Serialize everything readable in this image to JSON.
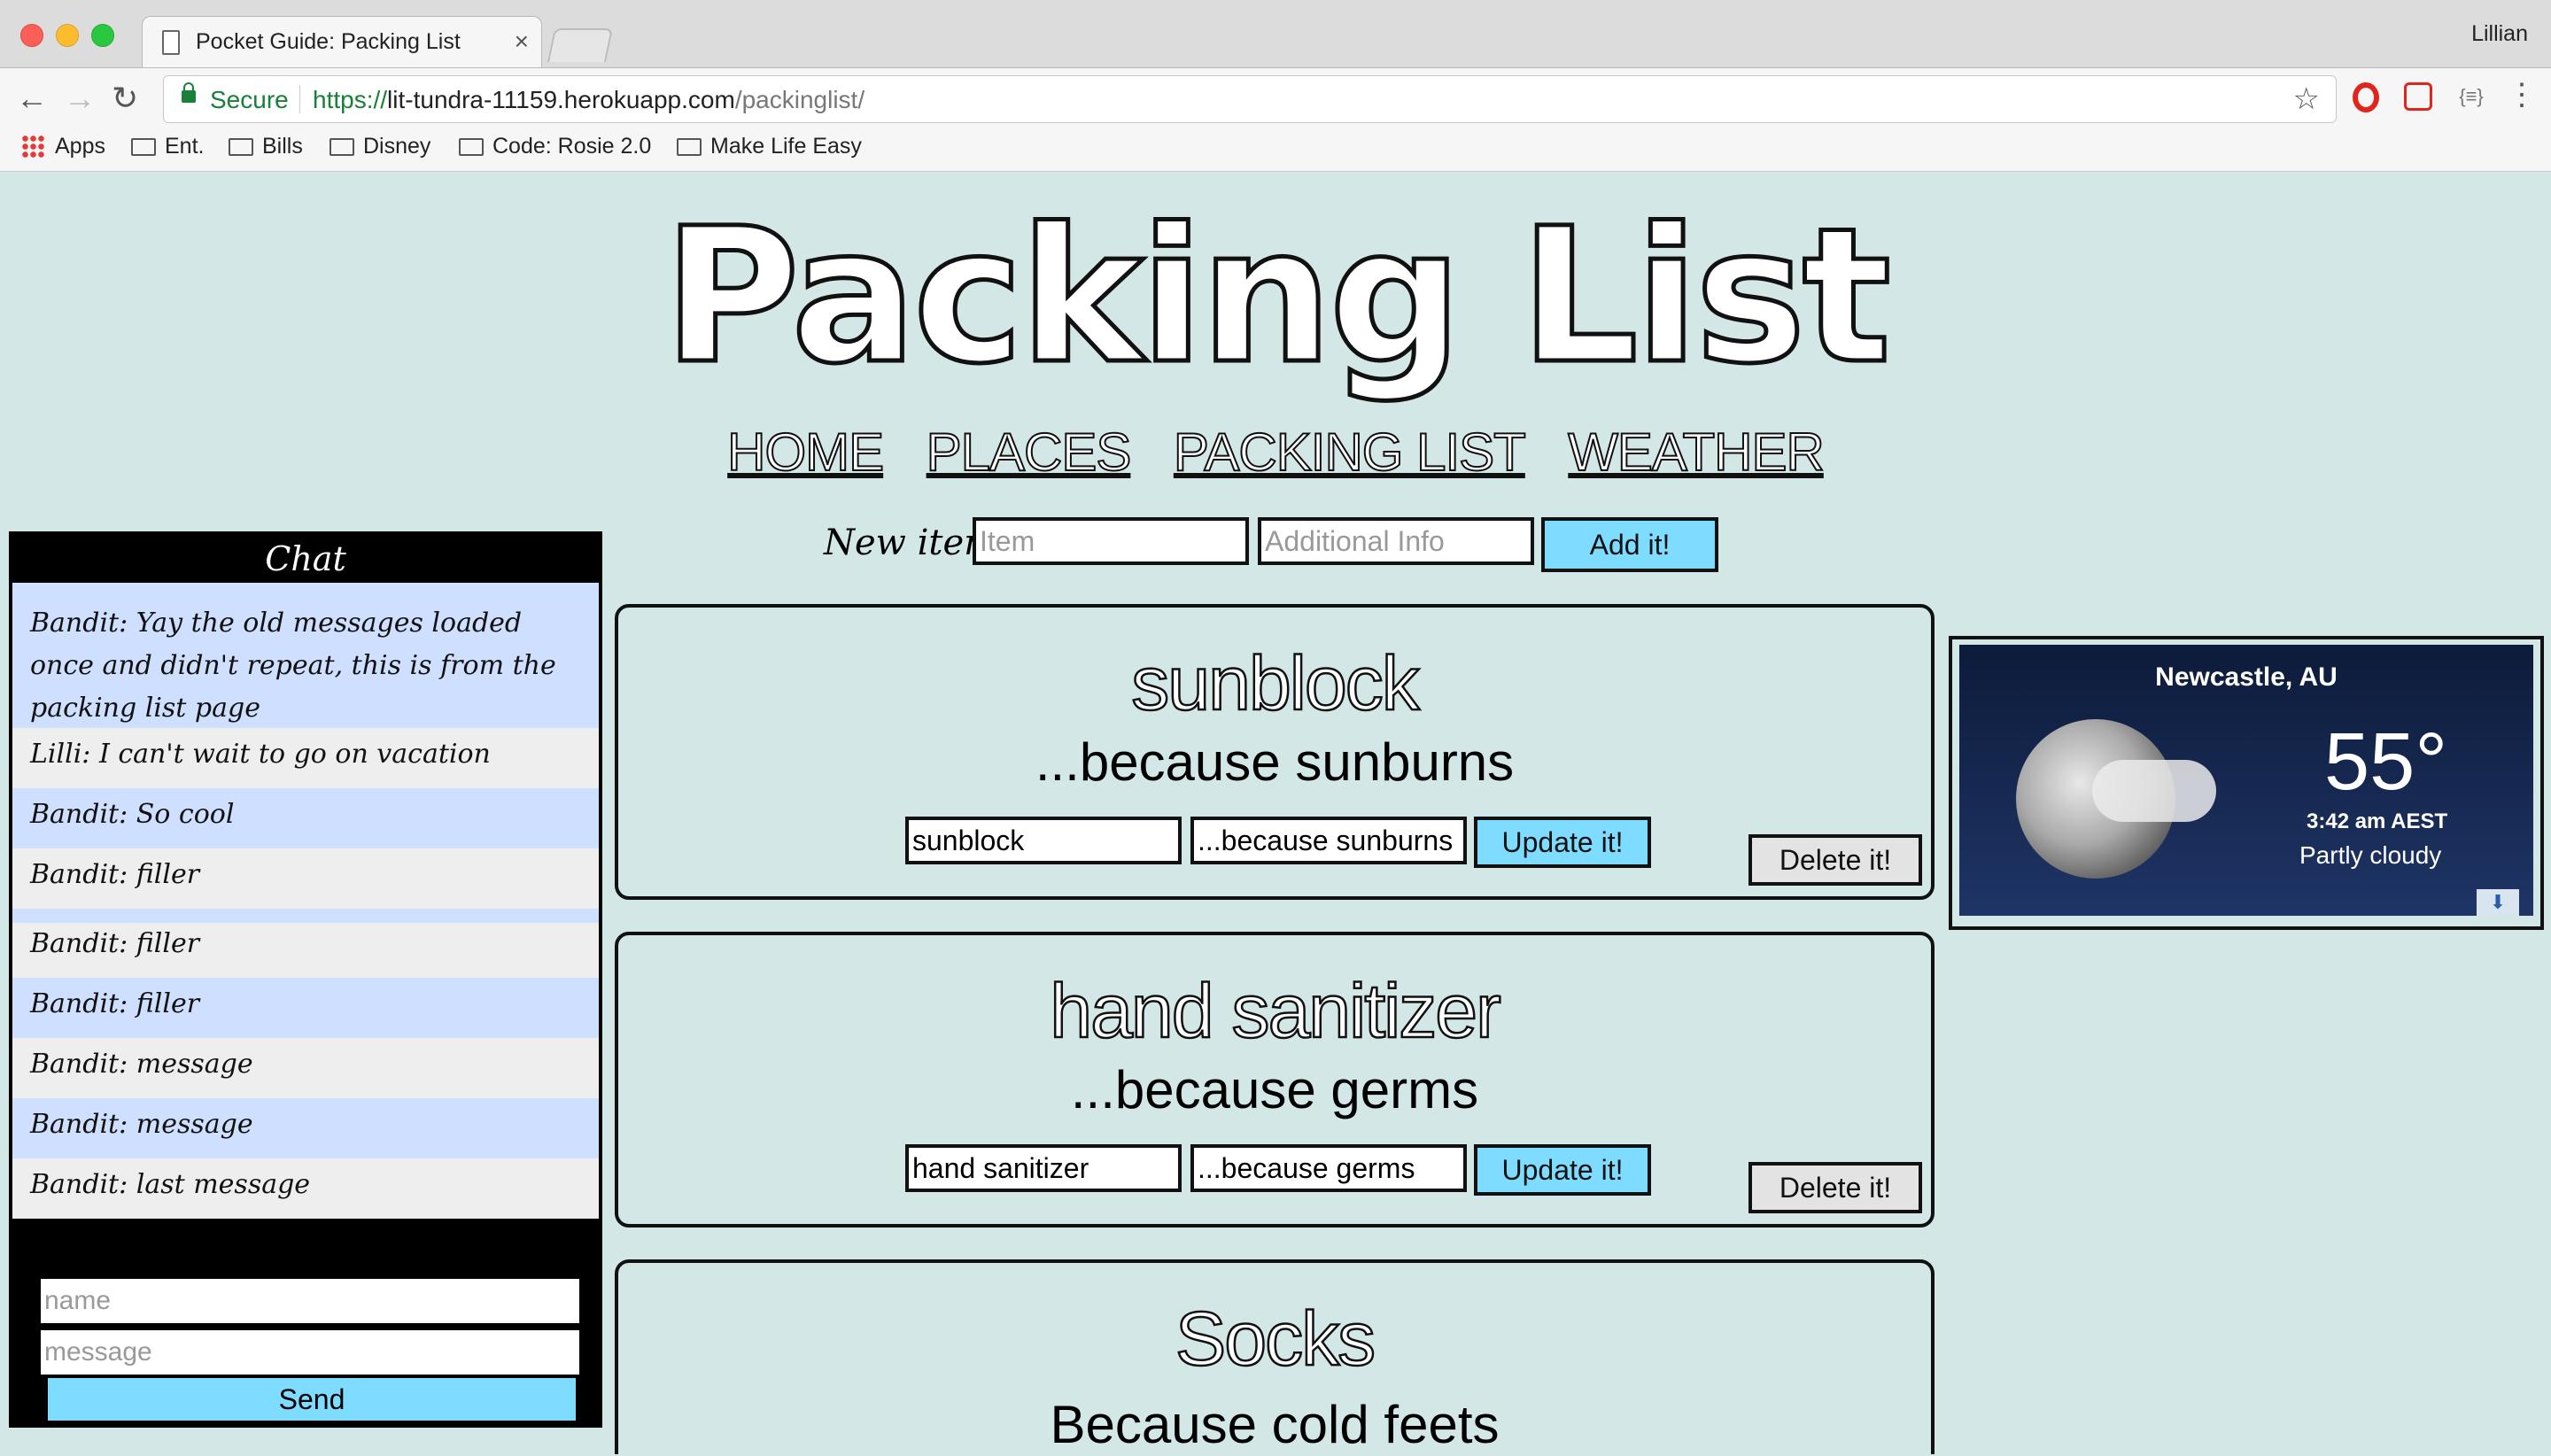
{
  "browser": {
    "tab_title": "Pocket Guide: Packing List",
    "tab_close": "×",
    "profile_name": "Lillian",
    "secure_label": "Secure",
    "url_scheme": "https://",
    "url_host": "lit-tundra-11159.herokuapp.com",
    "url_path": "/packinglist/",
    "nav": {
      "back": "←",
      "forward": "→",
      "reload": "↻"
    },
    "star": "☆",
    "menu": "⋮",
    "ext3_label": "{≡}",
    "bookmarks": [
      {
        "label": "Apps",
        "icon": "apps-grid-icon"
      },
      {
        "label": "Ent.",
        "icon": "folder-icon"
      },
      {
        "label": "Bills",
        "icon": "folder-icon"
      },
      {
        "label": "Disney",
        "icon": "folder-icon"
      },
      {
        "label": "Code: Rosie 2.0",
        "icon": "folder-icon"
      },
      {
        "label": "Make Life Easy",
        "icon": "folder-icon"
      }
    ]
  },
  "page": {
    "title": "Packing List",
    "nav": [
      "HOME",
      "PLACES",
      "PACKING LIST",
      "WEATHER"
    ],
    "new_item": {
      "label": "New item:",
      "item_placeholder": "Item",
      "info_placeholder": "Additional Info",
      "add_label": "Add it!"
    },
    "items": [
      {
        "name": "sunblock",
        "reason": "...because sunburns",
        "name_value": "sunblock",
        "reason_value": "...because sunburns",
        "update_label": "Update it!",
        "delete_label": "Delete it!"
      },
      {
        "name": "hand sanitizer",
        "reason": "...because germs",
        "name_value": "hand sanitizer",
        "reason_value": "...because germs",
        "update_label": "Update it!",
        "delete_label": "Delete it!"
      },
      {
        "name": "Socks",
        "reason": "Because cold feets"
      }
    ]
  },
  "chat": {
    "header": "Chat",
    "messages": [
      {
        "text": "Bandit: Yay the old messages loaded once and didn't repeat, this is from the packing list page"
      },
      {
        "text": "Lilli: I can't wait to go on vacation"
      },
      {
        "text": "Bandit: So cool"
      },
      {
        "text": "Bandit: filler"
      },
      {
        "text": "Bandit: filler"
      },
      {
        "text": "Bandit: filler"
      },
      {
        "text": "Bandit: filler"
      },
      {
        "text": "Bandit: message"
      },
      {
        "text": "Bandit: message"
      },
      {
        "text": "Bandit: last message"
      }
    ],
    "name_placeholder": "name",
    "message_placeholder": "message",
    "send_label": "Send"
  },
  "weather": {
    "city": "Newcastle, AU",
    "temperature": "55°",
    "time": "3:42 am AEST",
    "condition": "Partly cloudy",
    "download_icon": "⬇"
  },
  "colors": {
    "page_bg": "#d3e7e6",
    "button_blue": "#7ddcff",
    "chat_blue": "#cfdfff",
    "chat_grey": "#eeeeee",
    "secure_green": "#188038"
  }
}
